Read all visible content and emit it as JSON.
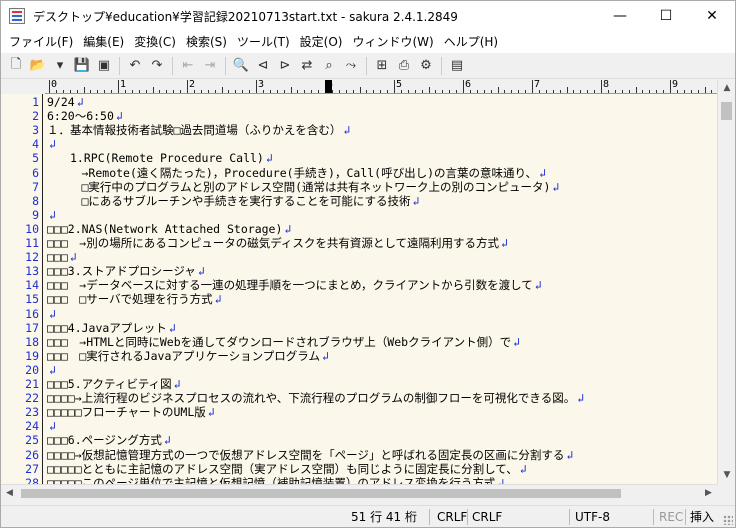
{
  "window": {
    "title": "デスクトップ¥education¥学習記録20210713start.txt - sakura 2.4.1.2849",
    "minimize_glyph": "—",
    "maximize_glyph": "☐",
    "close_glyph": "✕"
  },
  "menu": [
    {
      "label": "ファイル(F)",
      "icon": "menu-file"
    },
    {
      "label": "編集(E)",
      "icon": "menu-edit"
    },
    {
      "label": "変換(C)",
      "icon": "menu-convert"
    },
    {
      "label": "検索(S)",
      "icon": "menu-search"
    },
    {
      "label": "ツール(T)",
      "icon": "menu-tools"
    },
    {
      "label": "設定(O)",
      "icon": "menu-settings"
    },
    {
      "label": "ウィンドウ(W)",
      "icon": "menu-window"
    },
    {
      "label": "ヘルプ(H)",
      "icon": "menu-help"
    }
  ],
  "toolbar": [
    {
      "icon": "new-file-icon",
      "glyph": "🗋"
    },
    {
      "icon": "open-folder-icon",
      "glyph": "📂"
    },
    {
      "icon": "dropdown-arrow-icon",
      "glyph": "▾"
    },
    {
      "icon": "save-icon",
      "glyph": "💾"
    },
    {
      "icon": "save-all-icon",
      "glyph": "▣"
    },
    {
      "icon": "undo-icon",
      "glyph": "↶"
    },
    {
      "icon": "redo-icon",
      "glyph": "↷"
    },
    {
      "icon": "back-icon",
      "glyph": "⇤"
    },
    {
      "icon": "forward-icon",
      "glyph": "⇥"
    },
    {
      "icon": "search-icon",
      "glyph": "🔍"
    },
    {
      "icon": "search-prev-icon",
      "glyph": "⊲"
    },
    {
      "icon": "search-next-icon",
      "glyph": "⊳"
    },
    {
      "icon": "replace-icon",
      "glyph": "⇄"
    },
    {
      "icon": "grep-icon",
      "glyph": "⌕"
    },
    {
      "icon": "tag-jump-icon",
      "glyph": "⤳"
    },
    {
      "icon": "compare-icon",
      "glyph": "⊞"
    },
    {
      "icon": "print-preview-icon",
      "glyph": "⎙"
    },
    {
      "icon": "settings-icon",
      "glyph": "⚙"
    },
    {
      "icon": "outline-icon",
      "glyph": "▤"
    }
  ],
  "ruler": {
    "labels": [
      "0",
      "1",
      "2",
      "3",
      "4",
      "5",
      "6",
      "7",
      "8",
      "9"
    ],
    "cursor_column": 40
  },
  "editor": {
    "eol_glyph": "↲",
    "lines": [
      {
        "n": "1",
        "text": "9/24"
      },
      {
        "n": "2",
        "text": "6:20〜6:50"
      },
      {
        "n": "3",
        "text": "１．基本情報技術者試験□過去問道場（ふりかえを含む）"
      },
      {
        "n": "4",
        "text": ""
      },
      {
        "n": "5",
        "text": "　　1.RPC(Remote Procedure Call)"
      },
      {
        "n": "6",
        "text": "　　　→Remote(遠く隔たった)，Procedure(手続き)，Call(呼び出し)の言葉の意味通り、"
      },
      {
        "n": "7",
        "text": "　　　□実行中のプログラムと別のアドレス空間(通常は共有ネットワーク上の別のコンピュータ)"
      },
      {
        "n": "8",
        "text": "　　　□にあるサブルーチンや手続きを実行することを可能にする技術"
      },
      {
        "n": "9",
        "text": ""
      },
      {
        "n": "10",
        "text": "□□□2.NAS(Network Attached Storage)"
      },
      {
        "n": "11",
        "text": "□□□　→別の場所にあるコンピュータの磁気ディスクを共有資源として遠隔利用する方式"
      },
      {
        "n": "12",
        "text": "□□□"
      },
      {
        "n": "13",
        "text": "□□□3.ストアドプロシージャ"
      },
      {
        "n": "14",
        "text": "□□□　→データベースに対する一連の処理手順を一つにまとめ，クライアントから引数を渡して"
      },
      {
        "n": "15",
        "text": "□□□　□サーバで処理を行う方式"
      },
      {
        "n": "16",
        "text": ""
      },
      {
        "n": "17",
        "text": "□□□4.Javaアプレット"
      },
      {
        "n": "18",
        "text": "□□□　→HTMLと同時にWebを通してダウンロードされブラウザ上（Webクライアント側）で"
      },
      {
        "n": "19",
        "text": "□□□　□実行されるJavaアプリケーションプログラム"
      },
      {
        "n": "20",
        "text": ""
      },
      {
        "n": "21",
        "text": "□□□5.アクティビティ図"
      },
      {
        "n": "22",
        "text": "□□□□→上流行程のビジネスプロセスの流れや、下流行程のプログラムの制御フローを可視化できる図。"
      },
      {
        "n": "23",
        "text": "□□□□□フローチャートのUML版"
      },
      {
        "n": "24",
        "text": ""
      },
      {
        "n": "25",
        "text": "□□□6.ページング方式"
      },
      {
        "n": "26",
        "text": "□□□□→仮想記憶管理方式の一つで仮想アドレス空間を「ページ」と呼ばれる固定長の区画に分割する"
      },
      {
        "n": "27",
        "text": "□□□□□とともに主記憶のアドレス空間（実アドレス空間）も同じように固定長に分割して、"
      },
      {
        "n": "28",
        "text": "□□□□□このページ単位で主記憶と仮想記憶（補助記憶装置）のアドレス変換を行う方式"
      }
    ]
  },
  "statusbar": {
    "position": "51 行  41 桁",
    "eol1": "CRLF",
    "eol2": "CRLF",
    "encoding": "UTF-8",
    "rec": "REC",
    "mode": "挿入"
  },
  "colors": {
    "line_number": "#1a2fd4",
    "editor_bg": "#fbf7ea"
  }
}
